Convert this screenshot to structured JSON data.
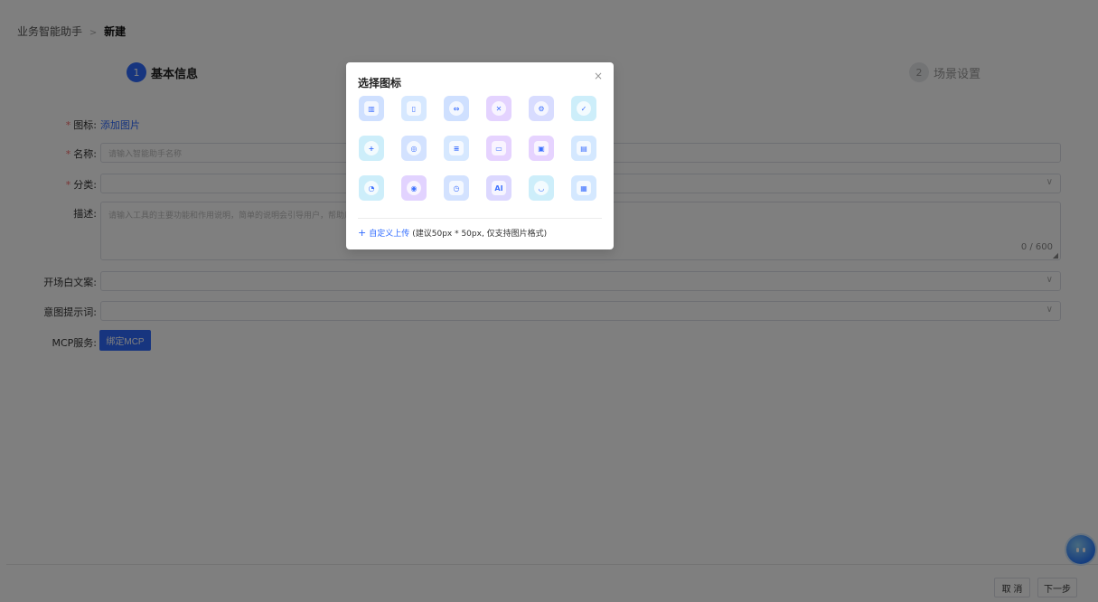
{
  "breadcrumb": {
    "root": "业务智能助手",
    "separator": ">",
    "current": "新建"
  },
  "steps": [
    {
      "num": "1",
      "label": "基本信息"
    },
    {
      "num": "2",
      "label": "场景设置"
    }
  ],
  "form": {
    "icon": {
      "label": "图标",
      "link": "添加图片"
    },
    "name": {
      "label": "名称",
      "placeholder": "请输入智能助手名称"
    },
    "category": {
      "label": "分类"
    },
    "description": {
      "label": "描述",
      "placeholder": "请输入工具的主要功能和作用说明，简单的说明会引导用户，帮助用",
      "counter": "0 / 600"
    },
    "opening": {
      "label": "开场白文案"
    },
    "intent": {
      "label": "意图提示词"
    },
    "mcp": {
      "label": "MCP服务",
      "button": "绑定MCP"
    }
  },
  "footer": {
    "cancel": "取 消",
    "next": "下一步"
  },
  "modal": {
    "title": "选择图标",
    "close": "×",
    "icons": [
      {
        "name": "chart-doc-icon",
        "bg": "#cfe0ff",
        "glyph": "▥",
        "shape": "square"
      },
      {
        "name": "tablet-icon",
        "bg": "#d6e8ff",
        "glyph": "▯",
        "shape": "square"
      },
      {
        "name": "swap-icon",
        "bg": "#cfe0ff",
        "glyph": "⇔",
        "shape": "round"
      },
      {
        "name": "cancel-circle-icon",
        "bg": "#e4d3ff",
        "glyph": "✕",
        "shape": "round"
      },
      {
        "name": "settings-circle-icon",
        "bg": "#d8dcff",
        "glyph": "⚙",
        "shape": "round"
      },
      {
        "name": "shield-check-icon",
        "bg": "#cdeefa",
        "glyph": "✓",
        "shape": "round"
      },
      {
        "name": "shield-plus-icon",
        "bg": "#cdeefa",
        "glyph": "+",
        "shape": "round"
      },
      {
        "name": "gamepad-icon",
        "bg": "#d3e2ff",
        "glyph": "◎",
        "shape": "round"
      },
      {
        "name": "document-list-icon",
        "bg": "#d6e8ff",
        "glyph": "≡",
        "shape": "square"
      },
      {
        "name": "user-card-icon",
        "bg": "#e6d3ff",
        "glyph": "▭",
        "shape": "square"
      },
      {
        "name": "id-card-icon",
        "bg": "#e6d3ff",
        "glyph": "▣",
        "shape": "square"
      },
      {
        "name": "book-icon",
        "bg": "#d4e8ff",
        "glyph": "▤",
        "shape": "square"
      },
      {
        "name": "message-icon",
        "bg": "#cdeefa",
        "glyph": "◔",
        "shape": "round"
      },
      {
        "name": "target-icon",
        "bg": "#e2d3ff",
        "glyph": "◉",
        "shape": "round"
      },
      {
        "name": "clock-doc-icon",
        "bg": "#d3e2ff",
        "glyph": "◷",
        "shape": "square"
      },
      {
        "name": "ai-doc-icon",
        "bg": "#dcd8ff",
        "glyph": "AI",
        "shape": "square"
      },
      {
        "name": "chat-bubble-icon",
        "bg": "#cdeefa",
        "glyph": "◡",
        "shape": "round"
      },
      {
        "name": "note-icon",
        "bg": "#d4e8ff",
        "glyph": "▦",
        "shape": "square"
      }
    ],
    "upload": {
      "plus": "+",
      "link": "自定义上传",
      "hint": "(建议50px * 50px, 仅支持图片格式)"
    }
  }
}
